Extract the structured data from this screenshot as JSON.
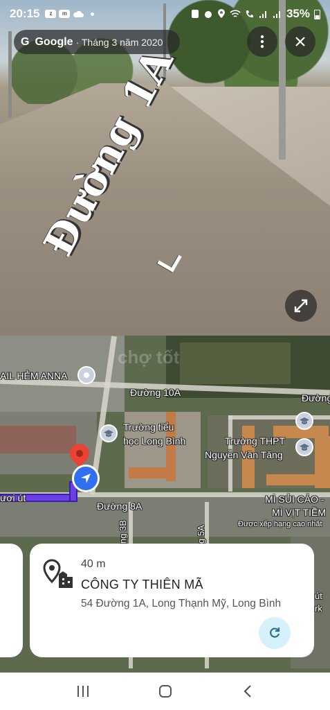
{
  "status_bar": {
    "time": "20:15",
    "notifications": [
      "zalo-icon",
      "momo-icon",
      "cloud-icon",
      "dot"
    ],
    "battery": "35%"
  },
  "street_view": {
    "provider": "Google",
    "date": "· Tháng 3 năm 2020",
    "street_label": "Đường 1A"
  },
  "map": {
    "labels": {
      "place_anna": "AIL HẺM ANNA",
      "road_10a": "Đường 10A",
      "road_10a_right": "Đường",
      "school_primary_1": "Trường tiểu",
      "school_primary_2": "học Long Bình",
      "school_high_1": "Trường THPT",
      "school_high_2": "Nguyễn Văn Tăng",
      "noodle_1": "MÌ SỦI CẢO -",
      "noodle_2": "MÌ VỊT TIỀM",
      "noodle_3": "Được xếp hạng cao nhất",
      "road_8a": "Đường 8A",
      "road_3b": "ng 3B",
      "road_5a": "g 5A",
      "left_place": "ươi út",
      "right_edge_1": "út",
      "right_edge_2": "rk",
      "watermark": "chợ tốt"
    },
    "colors": {
      "route": "#6a40e6",
      "nav": "#2f6ff0",
      "pin": "#ea4335"
    }
  },
  "info_card": {
    "distance": "40 m",
    "name": "CÔNG TY THIÊN MÃ",
    "address": "54 Đường 1A, Long Thạnh Mỹ, Long Bình"
  }
}
